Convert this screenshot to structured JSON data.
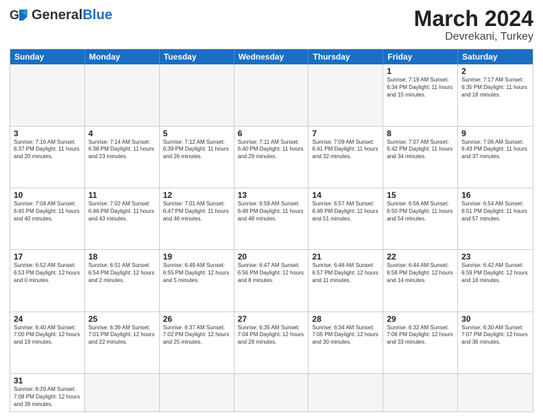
{
  "header": {
    "logo_general": "General",
    "logo_blue": "Blue",
    "month_title": "March 2024",
    "location": "Devrekani, Turkey"
  },
  "days_of_week": [
    "Sunday",
    "Monday",
    "Tuesday",
    "Wednesday",
    "Thursday",
    "Friday",
    "Saturday"
  ],
  "weeks": [
    [
      {
        "day": "",
        "info": "",
        "empty": true
      },
      {
        "day": "",
        "info": "",
        "empty": true
      },
      {
        "day": "",
        "info": "",
        "empty": true
      },
      {
        "day": "",
        "info": "",
        "empty": true
      },
      {
        "day": "",
        "info": "",
        "empty": true
      },
      {
        "day": "1",
        "info": "Sunrise: 7:19 AM\nSunset: 6:34 PM\nDaylight: 11 hours\nand 15 minutes."
      },
      {
        "day": "2",
        "info": "Sunrise: 7:17 AM\nSunset: 6:35 PM\nDaylight: 11 hours\nand 18 minutes."
      }
    ],
    [
      {
        "day": "3",
        "info": "Sunrise: 7:16 AM\nSunset: 6:37 PM\nDaylight: 11 hours\nand 20 minutes."
      },
      {
        "day": "4",
        "info": "Sunrise: 7:14 AM\nSunset: 6:38 PM\nDaylight: 11 hours\nand 23 minutes."
      },
      {
        "day": "5",
        "info": "Sunrise: 7:12 AM\nSunset: 6:39 PM\nDaylight: 11 hours\nand 26 minutes."
      },
      {
        "day": "6",
        "info": "Sunrise: 7:11 AM\nSunset: 6:40 PM\nDaylight: 11 hours\nand 29 minutes."
      },
      {
        "day": "7",
        "info": "Sunrise: 7:09 AM\nSunset: 6:41 PM\nDaylight: 11 hours\nand 32 minutes."
      },
      {
        "day": "8",
        "info": "Sunrise: 7:07 AM\nSunset: 6:42 PM\nDaylight: 11 hours\nand 34 minutes."
      },
      {
        "day": "9",
        "info": "Sunrise: 7:06 AM\nSunset: 6:43 PM\nDaylight: 11 hours\nand 37 minutes."
      }
    ],
    [
      {
        "day": "10",
        "info": "Sunrise: 7:04 AM\nSunset: 6:45 PM\nDaylight: 11 hours\nand 40 minutes."
      },
      {
        "day": "11",
        "info": "Sunrise: 7:02 AM\nSunset: 6:46 PM\nDaylight: 11 hours\nand 43 minutes."
      },
      {
        "day": "12",
        "info": "Sunrise: 7:01 AM\nSunset: 6:47 PM\nDaylight: 11 hours\nand 46 minutes."
      },
      {
        "day": "13",
        "info": "Sunrise: 6:59 AM\nSunset: 6:48 PM\nDaylight: 11 hours\nand 48 minutes."
      },
      {
        "day": "14",
        "info": "Sunrise: 6:57 AM\nSunset: 6:49 PM\nDaylight: 11 hours\nand 51 minutes."
      },
      {
        "day": "15",
        "info": "Sunrise: 6:56 AM\nSunset: 6:50 PM\nDaylight: 11 hours\nand 54 minutes."
      },
      {
        "day": "16",
        "info": "Sunrise: 6:54 AM\nSunset: 6:51 PM\nDaylight: 11 hours\nand 57 minutes."
      }
    ],
    [
      {
        "day": "17",
        "info": "Sunrise: 6:52 AM\nSunset: 6:53 PM\nDaylight: 12 hours\nand 0 minutes."
      },
      {
        "day": "18",
        "info": "Sunrise: 6:51 AM\nSunset: 6:54 PM\nDaylight: 12 hours\nand 2 minutes."
      },
      {
        "day": "19",
        "info": "Sunrise: 6:49 AM\nSunset: 6:55 PM\nDaylight: 12 hours\nand 5 minutes."
      },
      {
        "day": "20",
        "info": "Sunrise: 6:47 AM\nSunset: 6:56 PM\nDaylight: 12 hours\nand 8 minutes."
      },
      {
        "day": "21",
        "info": "Sunrise: 6:46 AM\nSunset: 6:57 PM\nDaylight: 12 hours\nand 11 minutes."
      },
      {
        "day": "22",
        "info": "Sunrise: 6:44 AM\nSunset: 6:58 PM\nDaylight: 12 hours\nand 14 minutes."
      },
      {
        "day": "23",
        "info": "Sunrise: 6:42 AM\nSunset: 6:59 PM\nDaylight: 12 hours\nand 16 minutes."
      }
    ],
    [
      {
        "day": "24",
        "info": "Sunrise: 6:40 AM\nSunset: 7:00 PM\nDaylight: 12 hours\nand 19 minutes."
      },
      {
        "day": "25",
        "info": "Sunrise: 6:39 AM\nSunset: 7:01 PM\nDaylight: 12 hours\nand 22 minutes."
      },
      {
        "day": "26",
        "info": "Sunrise: 6:37 AM\nSunset: 7:02 PM\nDaylight: 12 hours\nand 25 minutes."
      },
      {
        "day": "27",
        "info": "Sunrise: 6:35 AM\nSunset: 7:04 PM\nDaylight: 12 hours\nand 28 minutes."
      },
      {
        "day": "28",
        "info": "Sunrise: 6:34 AM\nSunset: 7:05 PM\nDaylight: 12 hours\nand 30 minutes."
      },
      {
        "day": "29",
        "info": "Sunrise: 6:32 AM\nSunset: 7:06 PM\nDaylight: 12 hours\nand 33 minutes."
      },
      {
        "day": "30",
        "info": "Sunrise: 6:30 AM\nSunset: 7:07 PM\nDaylight: 12 hours\nand 36 minutes."
      }
    ],
    [
      {
        "day": "31",
        "info": "Sunrise: 6:29 AM\nSunset: 7:08 PM\nDaylight: 12 hours\nand 39 minutes."
      },
      {
        "day": "",
        "info": "",
        "empty": true
      },
      {
        "day": "",
        "info": "",
        "empty": true
      },
      {
        "day": "",
        "info": "",
        "empty": true
      },
      {
        "day": "",
        "info": "",
        "empty": true
      },
      {
        "day": "",
        "info": "",
        "empty": true
      },
      {
        "day": "",
        "info": "",
        "empty": true
      }
    ]
  ]
}
